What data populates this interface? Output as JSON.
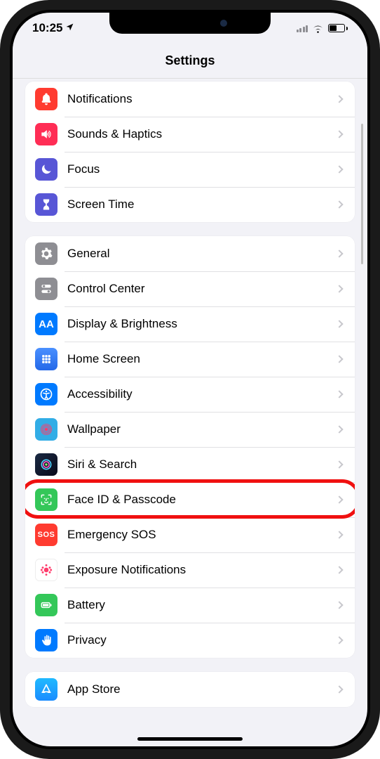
{
  "status": {
    "time": "10:25",
    "location_active": true
  },
  "header": {
    "title": "Settings"
  },
  "groups": [
    {
      "items": [
        {
          "key": "notifications",
          "icon": "bell-icon",
          "icon_bg": "bg-red",
          "label": "Notifications"
        },
        {
          "key": "sounds",
          "icon": "speaker-icon",
          "icon_bg": "bg-pink",
          "label": "Sounds & Haptics"
        },
        {
          "key": "focus",
          "icon": "moon-icon",
          "icon_bg": "bg-indigo",
          "label": "Focus"
        },
        {
          "key": "screentime",
          "icon": "hourglass-icon",
          "icon_bg": "bg-indigo",
          "label": "Screen Time"
        }
      ]
    },
    {
      "items": [
        {
          "key": "general",
          "icon": "gear-icon",
          "icon_bg": "bg-gray",
          "label": "General"
        },
        {
          "key": "controlcenter",
          "icon": "switches-icon",
          "icon_bg": "bg-gray",
          "label": "Control Center"
        },
        {
          "key": "display",
          "icon": "text-size-icon",
          "icon_bg": "bg-blue",
          "label": "Display & Brightness"
        },
        {
          "key": "homescreen",
          "icon": "grid-icon",
          "icon_bg": "bg-blue",
          "label": "Home Screen"
        },
        {
          "key": "accessibility",
          "icon": "accessibility-icon",
          "icon_bg": "bg-blue",
          "label": "Accessibility"
        },
        {
          "key": "wallpaper",
          "icon": "flower-icon",
          "icon_bg": "bg-cyan",
          "label": "Wallpaper"
        },
        {
          "key": "siri",
          "icon": "siri-icon",
          "icon_bg": "bg-siri",
          "label": "Siri & Search"
        },
        {
          "key": "faceid",
          "icon": "faceid-icon",
          "icon_bg": "bg-green",
          "label": "Face ID & Passcode",
          "highlighted": true
        },
        {
          "key": "sos",
          "icon": "sos-icon",
          "icon_bg": "bg-sos",
          "label": "Emergency SOS"
        },
        {
          "key": "exposure",
          "icon": "exposure-icon",
          "icon_bg": "bg-white",
          "label": "Exposure Notifications"
        },
        {
          "key": "battery",
          "icon": "battery-icon",
          "icon_bg": "bg-green",
          "label": "Battery"
        },
        {
          "key": "privacy",
          "icon": "hand-icon",
          "icon_bg": "bg-blue",
          "label": "Privacy"
        }
      ]
    },
    {
      "items": [
        {
          "key": "appstore",
          "icon": "appstore-icon",
          "icon_bg": "bg-blue",
          "label": "App Store"
        }
      ]
    }
  ],
  "sos_text": "SOS",
  "aa_text": "AA"
}
